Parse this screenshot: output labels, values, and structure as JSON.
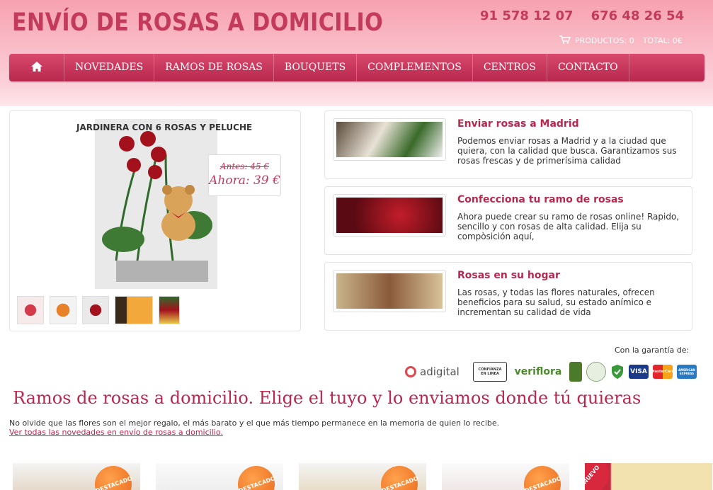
{
  "header": {
    "title": "ENVÍO DE ROSAS A DOMICILIO",
    "phones": "91 578 12 07    676 48 26 54",
    "cart": {
      "products_label": "PRODUCTOS: 0",
      "total_label": "TOTAL: 0€"
    }
  },
  "nav": {
    "items": [
      "NOVEDADES",
      "RAMOS DE ROSAS",
      "BOUQUETS",
      "COMPLEMENTOS",
      "CENTROS",
      "CONTACTO"
    ]
  },
  "product": {
    "title": "JARDINERA CON 6 ROSAS Y PELUCHE",
    "price_before": "Antes: 45 €",
    "price_now": "Ahora: 39 €"
  },
  "features": [
    {
      "title": "Enviar rosas a Madrid",
      "text": "Podemos enviar rosas a Madrid y a la ciudad que quiera, con la calidad que busca. Garantizamos sus rosas frescas y de primerísima calidad"
    },
    {
      "title": "Confecciona tu ramo de rosas",
      "text": "Ahora puede crear su ramo de rosas online! Rapido, sencillo y con rosas de alta calidad. Elija su compòsición aquí,"
    },
    {
      "title": "Rosas en su hogar",
      "text": "Las rosas, y todas las flores naturales, ofrecen beneficios para su salud, su estado anímico e incrementan su calidad de vida"
    }
  ],
  "guarantee": {
    "label": "Con la garantía de:",
    "badges": [
      "adigital",
      "CONFIANZA EN LINEA",
      "veriflora",
      "VISA",
      "MasterCard",
      "AMERICAN EXPRESS"
    ]
  },
  "main": {
    "heading": "Ramos de rosas a domicilio. Elige el tuyo y lo enviamos donde tú quieras",
    "intro": "No olvide que las flores son el mejor regalo, el más barato y el que más tiempo permanece en la memoria de quien lo recibe.",
    "link": "Ver todas las novedades en envío de rosas a domicilio."
  },
  "cards": {
    "stickers": [
      "DESTACADO",
      "DESTACADO",
      "DESTACADO",
      "DESTACADO",
      "NUEVO"
    ]
  },
  "colors": {
    "brand": "#c33a5d",
    "nav": "#c8365b"
  }
}
